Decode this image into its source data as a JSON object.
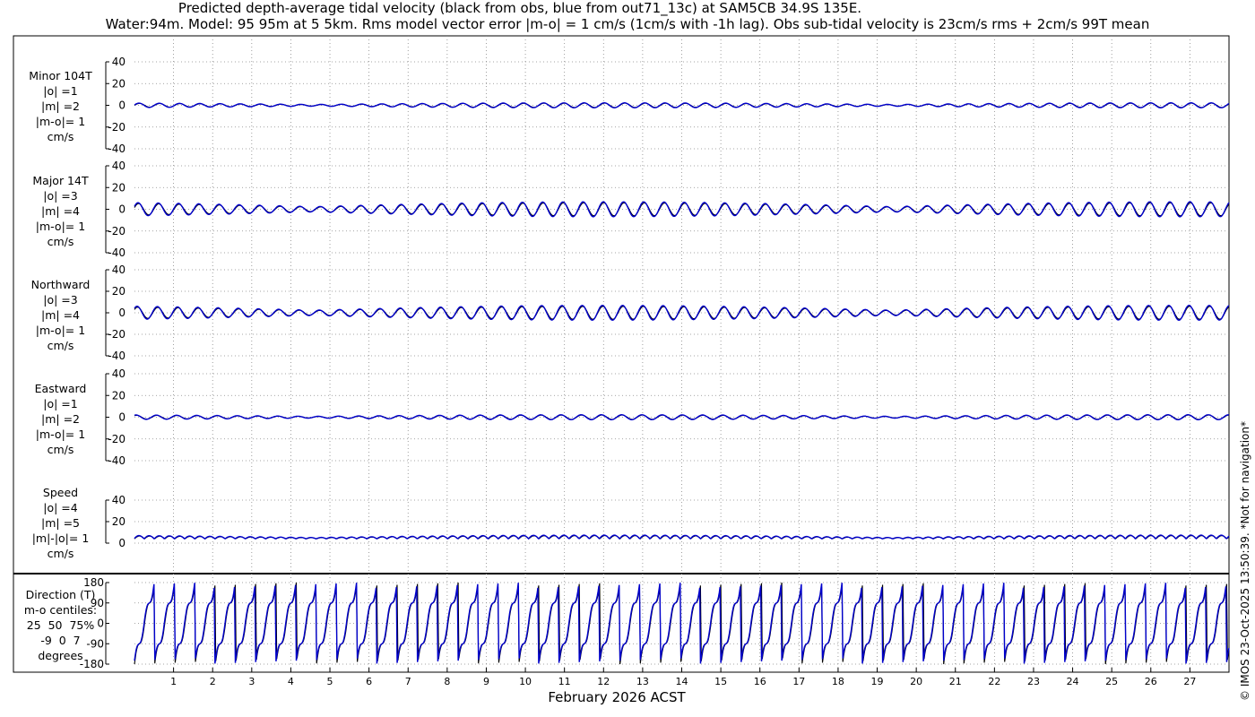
{
  "title_line1": "Predicted depth-average tidal velocity (black from obs, blue from out71_13c) at SAM5CB 34.9S 135E.",
  "title_line2": "Water:94m. Model: 95 95m at 5 5km. Rms model vector error |m-o| = 1 cm/s (1cm/s with -1h lag). Obs sub-tidal velocity is 23cm/s rms + 2cm/s 99T mean",
  "xlabel": "February 2026 ACST",
  "copyright": "© IMOS 23-Oct-2025 13:50:39. *Not for navigation*",
  "colors": {
    "obs": "#000000",
    "model": "#0000cc",
    "grid": "#888888"
  },
  "panels": [
    {
      "lines": [
        "Minor 104T",
        "|o| =1",
        "|m| =2",
        "|m-o|= 1",
        "cm/s"
      ]
    },
    {
      "lines": [
        "Major 14T",
        "|o| =3",
        "|m| =4",
        "|m-o|= 1",
        "cm/s"
      ]
    },
    {
      "lines": [
        "Northward",
        "|o| =3",
        "|m| =4",
        "|m-o|= 1",
        "cm/s"
      ]
    },
    {
      "lines": [
        "Eastward",
        "|o| =1",
        "|m| =2",
        "|m-o|= 1",
        "cm/s"
      ]
    },
    {
      "lines": [
        "Speed",
        "|o| =4",
        "|m| =5",
        "|m|-|o|= 1",
        "cm/s"
      ]
    },
    {
      "lines": [
        "Direction (T)",
        "m-o centiles:",
        "25  50  75%",
        "-9  0  7",
        "degrees"
      ]
    }
  ],
  "chart_data": {
    "type": "line",
    "x_ticks": [
      "1",
      "2",
      "3",
      "4",
      "5",
      "6",
      "7",
      "8",
      "9",
      "10",
      "11",
      "12",
      "13",
      "14",
      "15",
      "16",
      "17",
      "18",
      "19",
      "20",
      "21",
      "22",
      "23",
      "24",
      "25",
      "26",
      "27"
    ],
    "xlim": [
      0,
      28
    ],
    "panels": [
      {
        "name": "Minor 104T",
        "yticks": [
          "40",
          "20",
          "0",
          "-20",
          "-40"
        ],
        "ylim": [
          -40,
          40
        ],
        "amp": 2,
        "mean": 0
      },
      {
        "name": "Major 14T",
        "yticks": [
          "40",
          "20",
          "0",
          "-20",
          "-40"
        ],
        "ylim": [
          -40,
          40
        ],
        "amp": 6,
        "mean": 0
      },
      {
        "name": "Northward",
        "yticks": [
          "40",
          "20",
          "0",
          "-20",
          "-40"
        ],
        "ylim": [
          -40,
          40
        ],
        "amp": 6,
        "mean": 0
      },
      {
        "name": "Eastward",
        "yticks": [
          "40",
          "20",
          "0",
          "-20",
          "-40"
        ],
        "ylim": [
          -40,
          40
        ],
        "amp": 2,
        "mean": 0
      },
      {
        "name": "Speed",
        "yticks": [
          "40",
          "20",
          "0"
        ],
        "ylim": [
          0,
          40
        ],
        "amp": 3,
        "mean": 4
      },
      {
        "name": "Direction (T)",
        "yticks": [
          "180",
          "90",
          "0",
          "-90",
          "-180"
        ],
        "ylim": [
          -180,
          180
        ],
        "amp": 180,
        "mean": 0
      }
    ]
  }
}
